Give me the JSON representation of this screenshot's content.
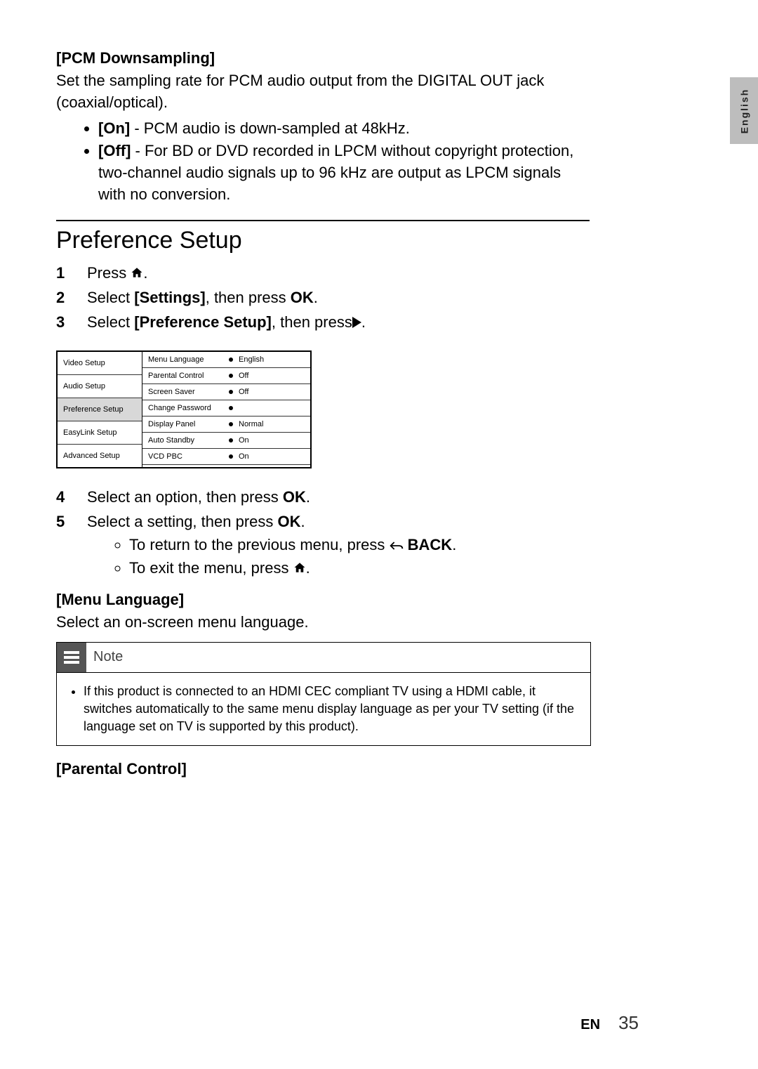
{
  "sideTab": "English",
  "pcm": {
    "heading": "[PCM Downsampling]",
    "desc": "Set the sampling rate for PCM audio output from the DIGITAL OUT jack (coaxial/optical).",
    "on_label": "[On]",
    "on_text": " - PCM audio is down-sampled at 48kHz.",
    "off_label": "[Off]",
    "off_text": " - For BD or DVD recorded in LPCM without copyright protection, two-channel audio signals up to 96 kHz are output as LPCM signals with no conversion."
  },
  "mainHeading": "Preference Setup",
  "steps": {
    "s1a": "Press ",
    "s1b": ".",
    "s2a": "Select ",
    "s2b": "[Settings]",
    "s2c": ", then press ",
    "s2d": "OK",
    "s2e": ".",
    "s3a": "Select ",
    "s3b": "[Preference Setup]",
    "s3c": ", then press",
    "s3d": ".",
    "s4a": "Select an option, then press ",
    "s4b": "OK",
    "s4c": ".",
    "s5a": "Select a setting, then press ",
    "s5b": "OK",
    "s5c": ".",
    "sub1a": "To return to the previous menu, press ",
    "sub1b": " BACK",
    "sub1c": ".",
    "sub2a": "To exit the menu, press ",
    "sub2b": "."
  },
  "numbers": {
    "n1": "1",
    "n2": "2",
    "n3": "3",
    "n4": "4",
    "n5": "5"
  },
  "settings": {
    "left": {
      "video": "Video Setup",
      "audio": "Audio Setup",
      "pref": "Preference Setup",
      "easy": "EasyLink Setup",
      "adv": "Advanced Setup"
    },
    "rows": {
      "r1l": "Menu Language",
      "r1v": "English",
      "r2l": "Parental Control",
      "r2v": "Off",
      "r3l": "Screen Saver",
      "r3v": "Off",
      "r4l": "Change Password",
      "r4v": "",
      "r5l": "Display Panel",
      "r5v": "Normal",
      "r6l": "Auto Standby",
      "r6v": "On",
      "r7l": "VCD PBC",
      "r7v": "On"
    }
  },
  "menuLang": {
    "heading": "[Menu Language]",
    "desc": "Select an on-screen menu language."
  },
  "note": {
    "title": "Note",
    "body": "If this product is connected to an HDMI CEC compliant TV using a HDMI cable, it switches automatically to the same menu display language as per your TV setting (if the language set on TV is supported by this product)."
  },
  "parental": {
    "heading": "[Parental Control]"
  },
  "footer": {
    "lang": "EN",
    "page": "35"
  }
}
